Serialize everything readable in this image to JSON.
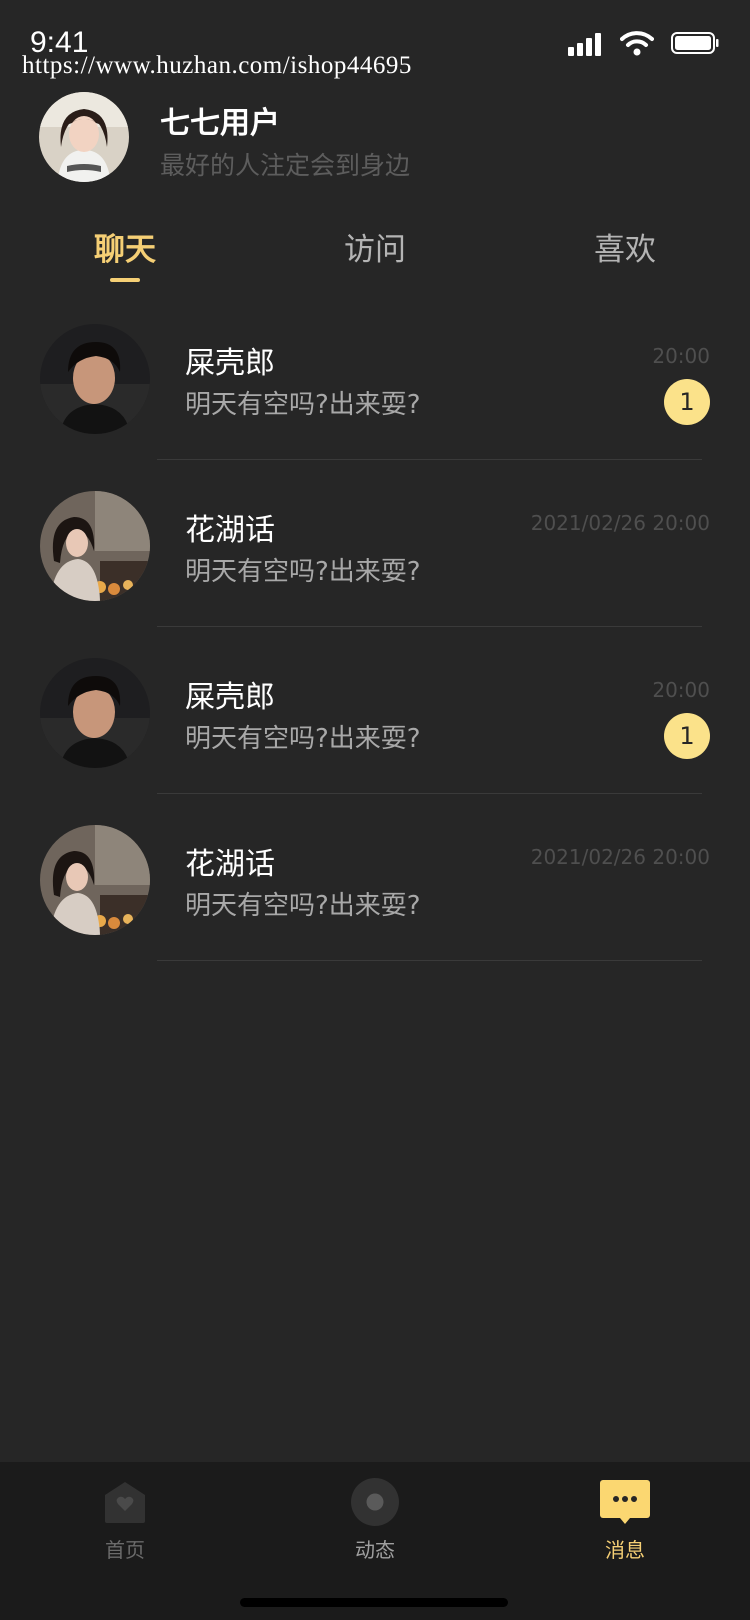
{
  "status_bar": {
    "time": "9:41"
  },
  "watermark": "https://www.huzhan.com/ishop44695",
  "profile": {
    "name": "七七用户",
    "subtitle": "最好的人注定会到身边"
  },
  "tabs": [
    {
      "label": "聊天",
      "active": true
    },
    {
      "label": "访问",
      "active": false
    },
    {
      "label": "喜欢",
      "active": false
    }
  ],
  "chats": [
    {
      "name": "屎壳郎",
      "message": "明天有空吗?出来耍?",
      "time": "20:00",
      "badge": "1",
      "avatar": "male-avatar"
    },
    {
      "name": "花湖话",
      "message": "明天有空吗?出来耍?",
      "time": "2021/02/26 20:00",
      "badge": "",
      "avatar": "female-avatar"
    },
    {
      "name": "屎壳郎",
      "message": "明天有空吗?出来耍?",
      "time": "20:00",
      "badge": "1",
      "avatar": "male-avatar"
    },
    {
      "name": "花湖话",
      "message": "明天有空吗?出来耍?",
      "time": "2021/02/26 20:00",
      "badge": "",
      "avatar": "female-avatar"
    }
  ],
  "bottom_nav": [
    {
      "label": "首页",
      "icon": "heart-icon",
      "active": false
    },
    {
      "label": "动态",
      "icon": "record-icon",
      "active": false
    },
    {
      "label": "消息",
      "icon": "message-icon",
      "active": true
    }
  ],
  "colors": {
    "accent": "#f5cf75",
    "badge": "#fbe28a",
    "background": "#262626",
    "nav_background": "#1b1b1b"
  }
}
